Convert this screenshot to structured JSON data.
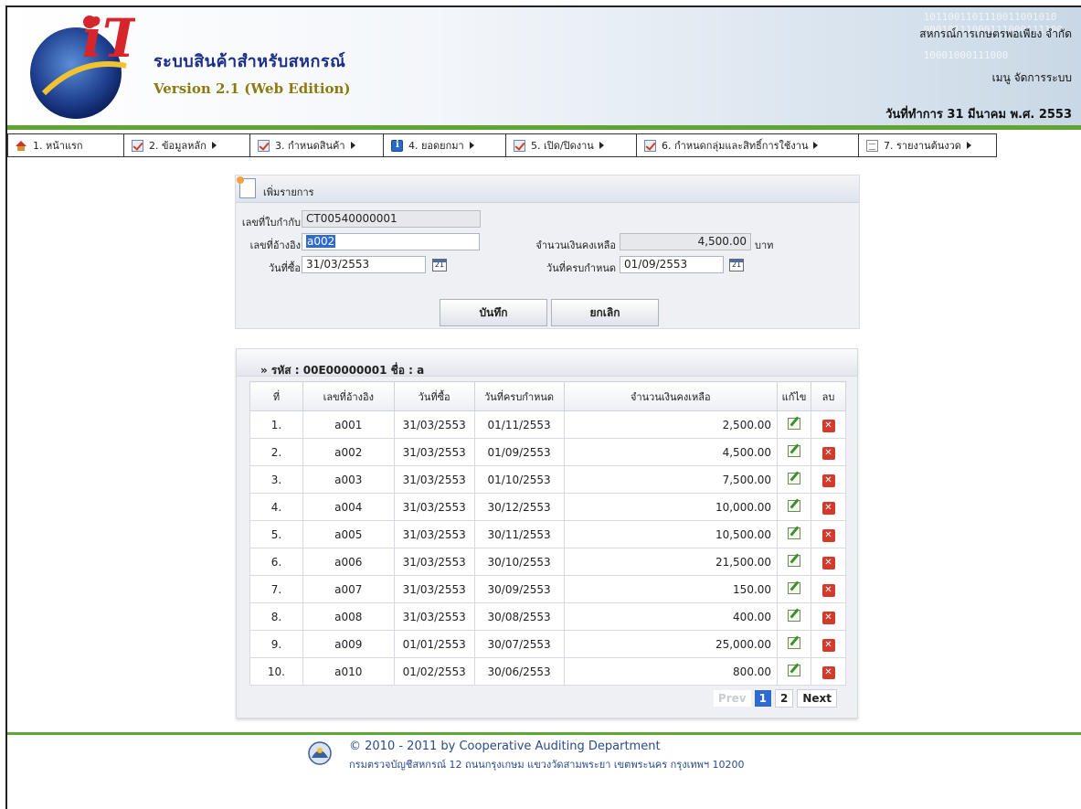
{
  "header": {
    "app_title": "ระบบสินค้าสำหรับสหกรณ์",
    "app_version": "Version 2.1 (Web Edition)",
    "coop_name": "สหกรณ์การเกษตรพอเพียง จำกัด",
    "menu_link": "เมนู จัดการระบบ",
    "work_date": "วันที่ทำการ 31 มีนาคม พ.ศ. 2553",
    "logo_text": "iT"
  },
  "menu": [
    {
      "label": "1. หน้าแรก",
      "icon": "home-icon",
      "has_submenu": false
    },
    {
      "label": "2. ข้อมูลหลัก",
      "icon": "checklist-icon",
      "has_submenu": true
    },
    {
      "label": "3. กำหนดสินค้า",
      "icon": "checklist-icon",
      "has_submenu": true
    },
    {
      "label": "4. ยอดยกมา",
      "icon": "info-icon",
      "has_submenu": true
    },
    {
      "label": "5. เปิด/ปิดงาน",
      "icon": "checklist-icon",
      "has_submenu": true
    },
    {
      "label": "6. กำหนดกลุ่มและสิทธิ์การใช้งาน",
      "icon": "checklist-icon",
      "has_submenu": true
    },
    {
      "label": "7. รายงานต้นงวด",
      "icon": "report-icon",
      "has_submenu": true
    }
  ],
  "form": {
    "title": "เพิ่มรายการ",
    "invoice_label": "เลขที่ใบกำกับ",
    "invoice_value": "CT00540000001",
    "ref_label": "เลขที่อ้างอิง",
    "ref_value": "a002",
    "balance_label": "จำนวนเงินคงเหลือ",
    "balance_value": "4,500.00",
    "balance_unit": "บาท",
    "buy_date_label": "วันที่ซื้อ",
    "buy_date_value": "31/03/2553",
    "due_date_label": "วันที่ครบกำหนด",
    "due_date_value": "01/09/2553",
    "calendar_text": "21",
    "save_label": "บันทึก",
    "cancel_label": "ยกเลิก"
  },
  "list": {
    "heading": "» รหัส : 00E00000001 ชื่อ : a",
    "columns": [
      "ที่",
      "เลขที่อ้างอิง",
      "วันที่ซื้อ",
      "วันที่ครบกำหนด",
      "จำนวนเงินคงเหลือ",
      "แก้ไข",
      "ลบ"
    ],
    "rows": [
      {
        "no": "1.",
        "ref": "a001",
        "buy": "31/03/2553",
        "due": "01/11/2553",
        "amount": "2,500.00"
      },
      {
        "no": "2.",
        "ref": "a002",
        "buy": "31/03/2553",
        "due": "01/09/2553",
        "amount": "4,500.00"
      },
      {
        "no": "3.",
        "ref": "a003",
        "buy": "31/03/2553",
        "due": "01/10/2553",
        "amount": "7,500.00"
      },
      {
        "no": "4.",
        "ref": "a004",
        "buy": "31/03/2553",
        "due": "30/12/2553",
        "amount": "10,000.00"
      },
      {
        "no": "5.",
        "ref": "a005",
        "buy": "31/03/2553",
        "due": "30/11/2553",
        "amount": "10,500.00"
      },
      {
        "no": "6.",
        "ref": "a006",
        "buy": "31/03/2553",
        "due": "30/10/2553",
        "amount": "21,500.00"
      },
      {
        "no": "7.",
        "ref": "a007",
        "buy": "31/03/2553",
        "due": "30/09/2553",
        "amount": "150.00"
      },
      {
        "no": "8.",
        "ref": "a008",
        "buy": "31/03/2553",
        "due": "30/08/2553",
        "amount": "400.00"
      },
      {
        "no": "9.",
        "ref": "a009",
        "buy": "01/01/2553",
        "due": "30/07/2553",
        "amount": "25,000.00"
      },
      {
        "no": "10.",
        "ref": "a010",
        "buy": "01/02/2553",
        "due": "30/06/2553",
        "amount": "800.00"
      }
    ],
    "pager": {
      "prev": "Prev",
      "pages": [
        "1",
        "2"
      ],
      "active": "1",
      "next": "Next"
    }
  },
  "footer": {
    "copyright": "© 2010 - 2011  by Cooperative Auditing Department",
    "address": "กรมตรวจบัญชีสหกรณ์ 12 ถนนกรุงเกษม แขวงวัดสามพระยา เขตพระนคร กรุงเทพฯ 10200"
  },
  "colors": {
    "accent_green": "#5fa534",
    "link_blue": "#2f6ad1",
    "title_blue": "#1b2f8a"
  }
}
